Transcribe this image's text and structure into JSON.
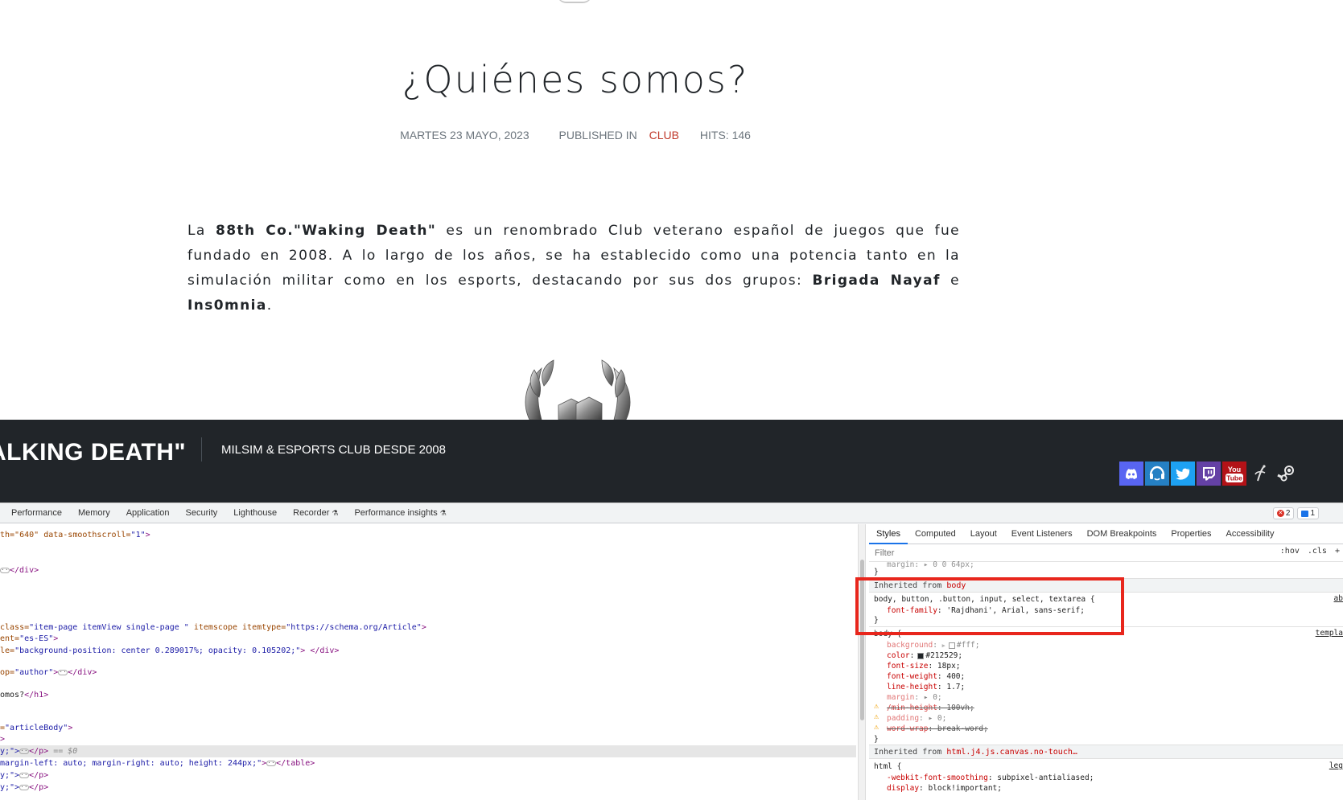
{
  "article": {
    "title": "¿Quiénes somos?",
    "meta_date": "MARTES 23 MAYO, 2023",
    "meta_published_in": "PUBLISHED IN",
    "meta_category": "CLUB",
    "meta_hits": "HITS: 146",
    "body": {
      "t1": "La ",
      "b1": "88th Co.\"Waking Death\"",
      "t2": " es un renombrado Club veterano español de juegos que fue fundado en 2008. A lo largo de los años, se ha establecido como una potencia tanto en la simulación militar  como en los esports, destacando por sus dos grupos: ",
      "b2": "Brigada Nayaf",
      "t3": " e ",
      "b3": "Ins0mnia",
      "t4": "."
    }
  },
  "site_header": {
    "brand": "ALKING DEATH\"",
    "tagline": "MILSIM & ESPORTS CLUB DESDE 2008",
    "social_icons": [
      "discord-icon",
      "teamspeak-icon",
      "twitter-icon",
      "twitch-icon",
      "youtube-icon",
      "steam-workshop-icon",
      "steam-icon"
    ],
    "youtube_label_top": "You",
    "youtube_label_bottom": "Tube"
  },
  "devtools": {
    "tabs": [
      {
        "label": "Performance",
        "beaker": ""
      },
      {
        "label": "Memory",
        "beaker": ""
      },
      {
        "label": "Application",
        "beaker": ""
      },
      {
        "label": "Security",
        "beaker": ""
      },
      {
        "label": "Lighthouse",
        "beaker": ""
      },
      {
        "label": "Recorder",
        "beaker": "⚗"
      },
      {
        "label": "Performance insights",
        "beaker": "⚗"
      }
    ],
    "error_count": "2",
    "message_count": "1",
    "elements": {
      "l1_a": "th=\"640\"",
      "l1_b": " data-smoothscroll=",
      "l1_c": "\"1\"",
      "l1_d": ">",
      "l2": "</div>",
      "l3_a": " class=",
      "l3_b": "\"item-page itemView single-page \"",
      "l3_c": " itemscope itemtype=",
      "l3_d": "\"https://schema.org/Article\"",
      "l3_e": ">",
      "l4_a": "ent=",
      "l4_b": "\"es-ES\"",
      "l4_c": ">",
      "l5_a": "le=",
      "l5_b": "\"background-position: center 0.289017%; opacity: 0.105202;\"",
      "l5_c": "> </div>",
      "l6_a": "op=",
      "l6_b": "\"author\"",
      "l6_c": ">",
      "l6_d": "</div>",
      "l7_a": "omos?",
      "l7_b": "</h1>",
      "l8_a": "=",
      "l8_b": "\"articleBody\"",
      "l8_c": ">",
      "l9": ">",
      "l10_a": "y;\">",
      "l10_b": "</p>",
      "l10_c": " == $0",
      "l11_a": "margin-left: auto; margin-right: auto; height: 244px;\"",
      "l11_b": ">",
      "l11_c": "</table>",
      "l12_a": "y;\">",
      "l12_b": "</p>",
      "l13_a": "y;\">",
      "l13_b": "</p>"
    },
    "styles_tabs": [
      "Styles",
      "Computed",
      "Layout",
      "Event Listeners",
      "DOM Breakpoints",
      "Properties",
      "Accessibility"
    ],
    "filter_placeholder": "Filter",
    "hov": ":hov",
    "cls": ".cls",
    "plus": "+",
    "prev_margin": "margin: ▸ 0 0 64px;",
    "inherited_body_label": "Inherited from",
    "inherited_body_src": "body",
    "rule1_selector": "body, button, .button, input, select, textarea {",
    "rule1_src": "ab",
    "rule1_prop": "font-family",
    "rule1_val": ": 'Rajdhani', Arial, sans-serif;",
    "close_brace": "}",
    "rule2_selector": "body {",
    "rule2_src": "templa",
    "rule2_props": [
      {
        "name": "background",
        "val": "#fff;",
        "swatch": "#ffffff"
      },
      {
        "name": "color",
        "val": "#212529;",
        "swatch": "#212529"
      },
      {
        "name": "font-size",
        "val": ": 18px;"
      },
      {
        "name": "font-weight",
        "val": ": 400;"
      },
      {
        "name": "line-height",
        "val": ": 1.7;"
      },
      {
        "name": "margin",
        "val": ": ▸ 0;"
      },
      {
        "name": "/min-height",
        "val": ": 100vh;"
      },
      {
        "name": "padding",
        "val": ": ▸ 0;"
      },
      {
        "name": "word-wrap",
        "val": ": break-word;"
      }
    ],
    "inherited_html_label": "Inherited from",
    "inherited_html_src": "html.j4.js.canvas.no-touch…",
    "rule3_selector": "html {",
    "rule3_src": "leg",
    "rule3_props": [
      {
        "name": "-webkit-font-smoothing",
        "val": ": subpixel-antialiased;"
      },
      {
        "name": "display",
        "val": ": block!important;"
      }
    ]
  }
}
